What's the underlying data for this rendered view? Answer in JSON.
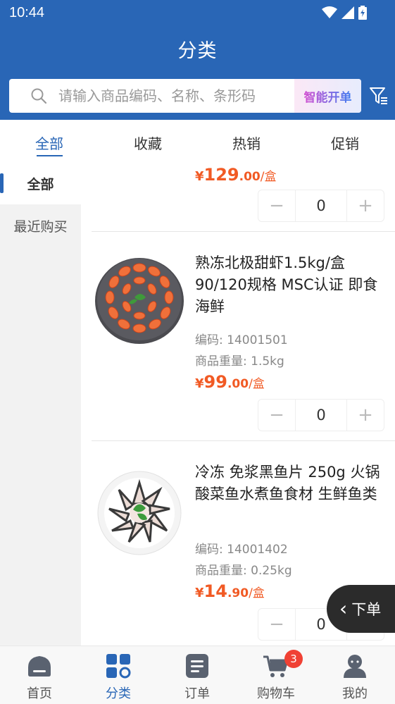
{
  "status_bar": {
    "time": "10:44"
  },
  "header": {
    "title": "分类"
  },
  "search": {
    "placeholder": "请输入商品编码、名称、条形码",
    "smart_order_label": "智能开单"
  },
  "tabs": [
    {
      "label": "全部",
      "active": true
    },
    {
      "label": "收藏",
      "active": false
    },
    {
      "label": "热销",
      "active": false
    },
    {
      "label": "促销",
      "active": false
    }
  ],
  "categories": [
    {
      "label": "全部",
      "active": true
    },
    {
      "label": "最近购买",
      "active": false
    }
  ],
  "products": [
    {
      "name": "",
      "price_symbol": "¥",
      "price_int": "129",
      "price_dec": ".00",
      "unit": "/盒",
      "quantity": "0"
    },
    {
      "name": "熟冻北极甜虾1.5kg/盒 90/120规格 MSC认证 即食 海鲜",
      "code_label": "编码: 14001501",
      "weight_label": "商品重量: 1.5kg",
      "price_symbol": "¥",
      "price_int": "99",
      "price_dec": ".00",
      "unit": "/盒",
      "quantity": "0"
    },
    {
      "name": "冷冻 免浆黑鱼片 250g 火锅酸菜鱼水煮鱼食材 生鲜鱼类",
      "code_label": "编码: 14001402",
      "weight_label": "商品重量: 0.25kg",
      "price_symbol": "¥",
      "price_int": "14",
      "price_dec": ".90",
      "unit": "/盒",
      "quantity": "0"
    }
  ],
  "stepper": {
    "minus": "−",
    "plus": "+"
  },
  "float_button": {
    "label": "下单",
    "chevron": "‹"
  },
  "bottom_nav": [
    {
      "label": "首页",
      "icon": "home-icon",
      "active": false
    },
    {
      "label": "分类",
      "icon": "category-icon",
      "active": true
    },
    {
      "label": "订单",
      "icon": "order-icon",
      "active": false
    },
    {
      "label": "购物车",
      "icon": "cart-icon",
      "active": false,
      "badge": "3"
    },
    {
      "label": "我的",
      "icon": "profile-icon",
      "active": false
    }
  ],
  "colors": {
    "primary": "#2966b6",
    "price": "#f15a24",
    "badge": "#f04134"
  }
}
